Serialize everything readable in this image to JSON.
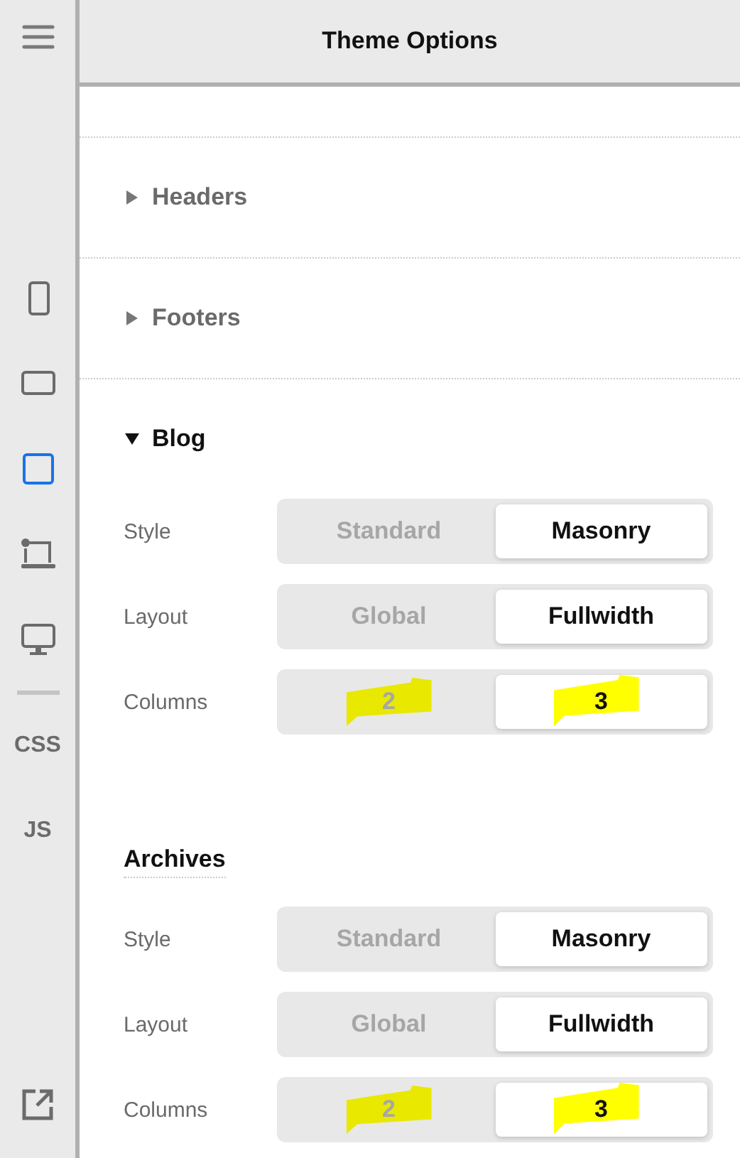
{
  "sidebar": {
    "items": [
      {
        "kind": "phone",
        "selected": false
      },
      {
        "kind": "tablet",
        "selected": false
      },
      {
        "kind": "square",
        "selected": true
      },
      {
        "kind": "laptop",
        "selected": false
      },
      {
        "kind": "desktop",
        "selected": false
      },
      {
        "kind": "divider"
      },
      {
        "kind": "text",
        "label": "CSS",
        "selected": false
      },
      {
        "kind": "text",
        "label": "JS",
        "selected": false
      }
    ]
  },
  "header": {
    "title": "Theme Options"
  },
  "sections": [
    {
      "kind": "collapsible",
      "title": "Headers",
      "expanded": false
    },
    {
      "kind": "collapsible",
      "title": "Footers",
      "expanded": false
    },
    {
      "kind": "collapsible",
      "title": "Blog",
      "expanded": true,
      "rows": [
        {
          "label": "Style",
          "options": [
            {
              "label": "Standard",
              "selected": false,
              "highlighted": false
            },
            {
              "label": "Masonry",
              "selected": true,
              "highlighted": false
            }
          ]
        },
        {
          "label": "Layout",
          "options": [
            {
              "label": "Global",
              "selected": false,
              "highlighted": false
            },
            {
              "label": "Fullwidth",
              "selected": true,
              "highlighted": false
            }
          ]
        },
        {
          "label": "Columns",
          "options": [
            {
              "label": "2",
              "selected": false,
              "highlighted": true
            },
            {
              "label": "3",
              "selected": true,
              "highlighted": true
            }
          ]
        }
      ]
    },
    {
      "kind": "heading",
      "title": "Archives",
      "rows": [
        {
          "label": "Style",
          "options": [
            {
              "label": "Standard",
              "selected": false,
              "highlighted": false
            },
            {
              "label": "Masonry",
              "selected": true,
              "highlighted": false
            }
          ]
        },
        {
          "label": "Layout",
          "options": [
            {
              "label": "Global",
              "selected": false,
              "highlighted": false
            },
            {
              "label": "Fullwidth",
              "selected": true,
              "highlighted": false
            }
          ]
        },
        {
          "label": "Columns",
          "options": [
            {
              "label": "2",
              "selected": false,
              "highlighted": true
            },
            {
              "label": "3",
              "selected": true,
              "highlighted": true
            }
          ]
        }
      ]
    }
  ]
}
